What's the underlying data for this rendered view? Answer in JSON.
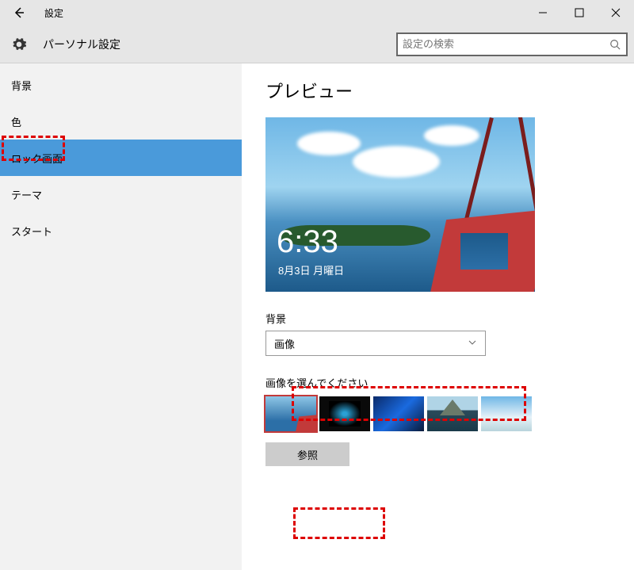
{
  "window": {
    "title": "設定"
  },
  "header": {
    "title": "パーソナル設定",
    "search_placeholder": "設定の検索"
  },
  "sidebar": {
    "items": [
      {
        "label": "背景"
      },
      {
        "label": "色"
      },
      {
        "label": "ロック画面",
        "selected": true
      },
      {
        "label": "テーマ"
      },
      {
        "label": "スタート"
      }
    ]
  },
  "content": {
    "preview_title": "プレビュー",
    "preview_time": "6:33",
    "preview_date": "8月3日 月曜日",
    "background_label": "背景",
    "background_dropdown": "画像",
    "choose_image_label": "画像を選んでください",
    "browse_button": "参照"
  }
}
